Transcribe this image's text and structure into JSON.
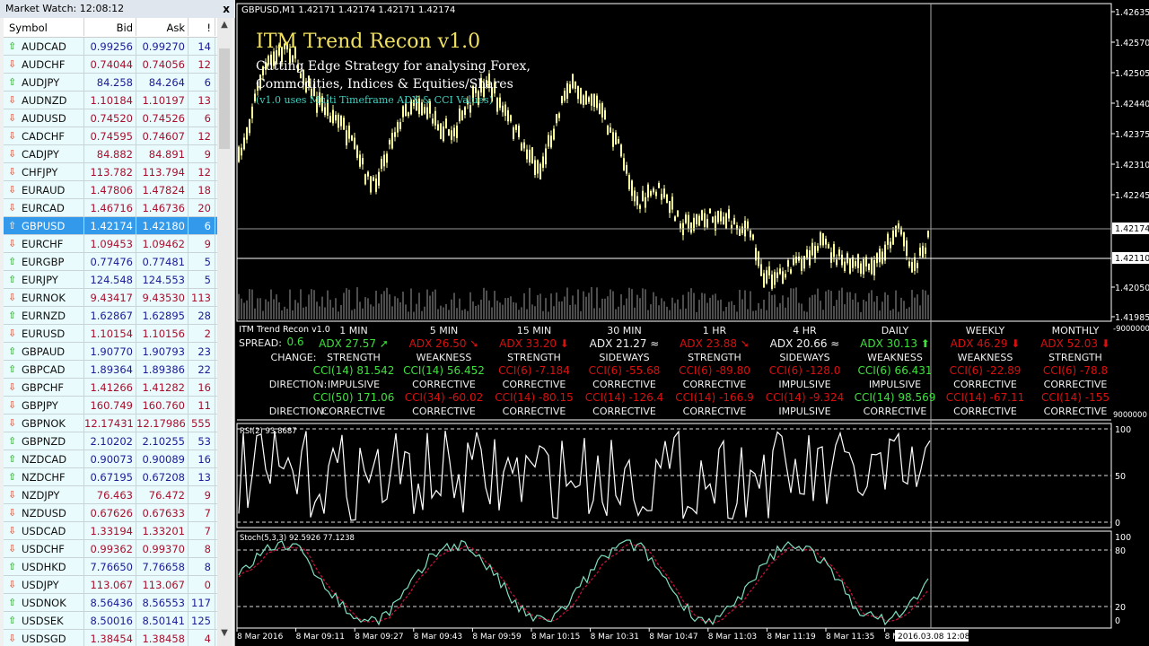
{
  "market_watch": {
    "title": "Market Watch: 12:08:12",
    "close": "x",
    "headers": {
      "symbol": "Symbol",
      "bid": "Bid",
      "ask": "Ask",
      "spread": "!"
    },
    "rows": [
      [
        "AUDCAD",
        "0.99256",
        "0.99270",
        "14",
        "up"
      ],
      [
        "AUDCHF",
        "0.74044",
        "0.74056",
        "12",
        "down"
      ],
      [
        "AUDJPY",
        "84.258",
        "84.264",
        "6",
        "up"
      ],
      [
        "AUDNZD",
        "1.10184",
        "1.10197",
        "13",
        "down"
      ],
      [
        "AUDUSD",
        "0.74520",
        "0.74526",
        "6",
        "down"
      ],
      [
        "CADCHF",
        "0.74595",
        "0.74607",
        "12",
        "down"
      ],
      [
        "CADJPY",
        "84.882",
        "84.891",
        "9",
        "down"
      ],
      [
        "CHFJPY",
        "113.782",
        "113.794",
        "12",
        "down"
      ],
      [
        "EURAUD",
        "1.47806",
        "1.47824",
        "18",
        "down"
      ],
      [
        "EURCAD",
        "1.46716",
        "1.46736",
        "20",
        "down"
      ],
      [
        "GBPUSD",
        "1.42174",
        "1.42180",
        "6",
        "up"
      ],
      [
        "EURCHF",
        "1.09453",
        "1.09462",
        "9",
        "down"
      ],
      [
        "EURGBP",
        "0.77476",
        "0.77481",
        "5",
        "up"
      ],
      [
        "EURJPY",
        "124.548",
        "124.553",
        "5",
        "up"
      ],
      [
        "EURNOK",
        "9.43417",
        "9.43530",
        "113",
        "down"
      ],
      [
        "EURNZD",
        "1.62867",
        "1.62895",
        "28",
        "up"
      ],
      [
        "EURUSD",
        "1.10154",
        "1.10156",
        "2",
        "down"
      ],
      [
        "GBPAUD",
        "1.90770",
        "1.90793",
        "23",
        "up"
      ],
      [
        "GBPCAD",
        "1.89364",
        "1.89386",
        "22",
        "up"
      ],
      [
        "GBPCHF",
        "1.41266",
        "1.41282",
        "16",
        "down"
      ],
      [
        "GBPJPY",
        "160.749",
        "160.760",
        "11",
        "down"
      ],
      [
        "GBPNOK",
        "12.17431",
        "12.17986",
        "555",
        "down"
      ],
      [
        "GBPNZD",
        "2.10202",
        "2.10255",
        "53",
        "up"
      ],
      [
        "NZDCAD",
        "0.90073",
        "0.90089",
        "16",
        "up"
      ],
      [
        "NZDCHF",
        "0.67195",
        "0.67208",
        "13",
        "up"
      ],
      [
        "NZDJPY",
        "76.463",
        "76.472",
        "9",
        "down"
      ],
      [
        "NZDUSD",
        "0.67626",
        "0.67633",
        "7",
        "down"
      ],
      [
        "USDCAD",
        "1.33194",
        "1.33201",
        "7",
        "down"
      ],
      [
        "USDCHF",
        "0.99362",
        "0.99370",
        "8",
        "down"
      ],
      [
        "USDHKD",
        "7.76650",
        "7.76658",
        "8",
        "up"
      ],
      [
        "USDJPY",
        "113.067",
        "113.067",
        "0",
        "down"
      ],
      [
        "USDNOK",
        "8.56436",
        "8.56553",
        "117",
        "up"
      ],
      [
        "USDSEK",
        "8.50016",
        "8.50141",
        "125",
        "up"
      ],
      [
        "USDSGD",
        "1.38454",
        "1.38458",
        "4",
        "down"
      ]
    ],
    "selected": "GBPUSD"
  },
  "chart": {
    "header": "GBPUSD,M1  1.42171 1.42174 1.42171 1.42174",
    "brand_title": "ITM Trend Recon v1.0",
    "brand_line1": "Cutting Edge Strategy for analysing Forex,",
    "brand_line2": "Commodities, Indices & Equities/Shares",
    "brand_line3": "(v1.0 uses Multi Timeframe ADX & CCI Values)",
    "price_ticks": [
      "1.42635",
      "1.42570",
      "1.42505",
      "1.42440",
      "1.42375",
      "1.42310",
      "1.42245",
      "1.42050",
      "1.41985"
    ],
    "bid_label": "1.42174",
    "line_label": "1.42110",
    "indicator_scale_top": "-9000000",
    "indicator_scale_bottom": "9000000",
    "rsi_label": "RSI(2) 93.8687",
    "rsi_ticks": [
      "100",
      "50",
      "0"
    ],
    "stoch_label": "Stoch(5,3,3) 92.5926 77.1238",
    "stoch_ticks": [
      "100",
      "80",
      "20",
      "0"
    ],
    "time_labels": [
      "8 Mar 2016",
      "8 Mar 09:11",
      "8 Mar 09:27",
      "8 Mar 09:43",
      "8 Mar 09:59",
      "8 Mar 10:15",
      "8 Mar 10:31",
      "8 Mar 10:47",
      "8 Mar 11:03",
      "8 Mar 11:19",
      "8 Mar 11:35",
      "8 Mar"
    ],
    "crosshair_time": "2016.03.08 12:08",
    "colors": {
      "candle": "#ffff99",
      "up": "#3ee03e",
      "down": "#d81010",
      "stoch_main": "#7fe0c0",
      "stoch_signal": "#c0103a"
    }
  },
  "panel": {
    "name": "ITM Trend Recon v1.0",
    "spread_label": "SPREAD:",
    "spread": "0.6",
    "change_label": "CHANGE:",
    "direction_label": "DIRECTION:",
    "columns": [
      {
        "tf": "1 MIN",
        "adx": "ADX 27.57",
        "adx_icon": "arrow-up-right",
        "adx_c": "g",
        "state": "STRENGTH",
        "cci1": "CCI(14) 81.542",
        "c1": "g",
        "dir1": "IMPULSIVE",
        "cci2": "CCI(50) 171.06",
        "c2": "g",
        "dir2": "CORRECTIVE"
      },
      {
        "tf": "5 MIN",
        "adx": "ADX 26.50",
        "adx_icon": "arrow-down-right",
        "adx_c": "r",
        "state": "WEAKNESS",
        "cci1": "CCI(14) 56.452",
        "c1": "g",
        "dir1": "CORRECTIVE",
        "cci2": "CCI(34) -60.02",
        "c2": "r",
        "dir2": "CORRECTIVE"
      },
      {
        "tf": "15 MIN",
        "adx": "ADX 33.20",
        "adx_icon": "arrow-down",
        "adx_c": "r",
        "state": "STRENGTH",
        "cci1": "CCI(6) -7.184",
        "c1": "r",
        "dir1": "CORRECTIVE",
        "cci2": "CCI(14) -80.15",
        "c2": "r",
        "dir2": "CORRECTIVE"
      },
      {
        "tf": "30 MIN",
        "adx": "ADX 21.27",
        "adx_icon": "sideways",
        "adx_c": "w",
        "state": "SIDEWAYS",
        "cci1": "CCI(6) -55.68",
        "c1": "r",
        "dir1": "CORRECTIVE",
        "cci2": "CCI(14) -126.4",
        "c2": "r",
        "dir2": "CORRECTIVE"
      },
      {
        "tf": "1 HR",
        "adx": "ADX 23.88",
        "adx_icon": "arrow-down-right",
        "adx_c": "r",
        "state": "STRENGTH",
        "cci1": "CCI(6) -89.80",
        "c1": "r",
        "dir1": "CORRECTIVE",
        "cci2": "CCI(14) -166.9",
        "c2": "r",
        "dir2": "CORRECTIVE"
      },
      {
        "tf": "4 HR",
        "adx": "ADX 20.66",
        "adx_icon": "sideways",
        "adx_c": "w",
        "state": "SIDEWAYS",
        "cci1": "CCI(6) -128.0",
        "c1": "r",
        "dir1": "IMPULSIVE",
        "cci2": "CCI(14) -9.324",
        "c2": "r",
        "dir2": "IMPULSIVE"
      },
      {
        "tf": "DAILY",
        "adx": "ADX 30.13",
        "adx_icon": "arrow-up",
        "adx_c": "g",
        "state": "WEAKNESS",
        "cci1": "CCI(6) 66.431",
        "c1": "g",
        "dir1": "IMPULSIVE",
        "cci2": "CCI(14) 98.569",
        "c2": "g",
        "dir2": "CORRECTIVE"
      },
      {
        "tf": "WEEKLY",
        "adx": "ADX 46.29",
        "adx_icon": "arrow-down",
        "adx_c": "r",
        "state": "WEAKNESS",
        "cci1": "CCI(6) -22.89",
        "c1": "r",
        "dir1": "CORRECTIVE",
        "cci2": "CCI(14) -67.11",
        "c2": "r",
        "dir2": "CORRECTIVE"
      },
      {
        "tf": "MONTHLY",
        "adx": "ADX 52.03",
        "adx_icon": "arrow-down",
        "adx_c": "r",
        "state": "STRENGTH",
        "cci1": "CCI(6) -78.8",
        "c1": "r",
        "dir1": "CORRECTIVE",
        "cci2": "CCI(14) -155",
        "c2": "r",
        "dir2": "CORRECTIVE"
      }
    ]
  }
}
